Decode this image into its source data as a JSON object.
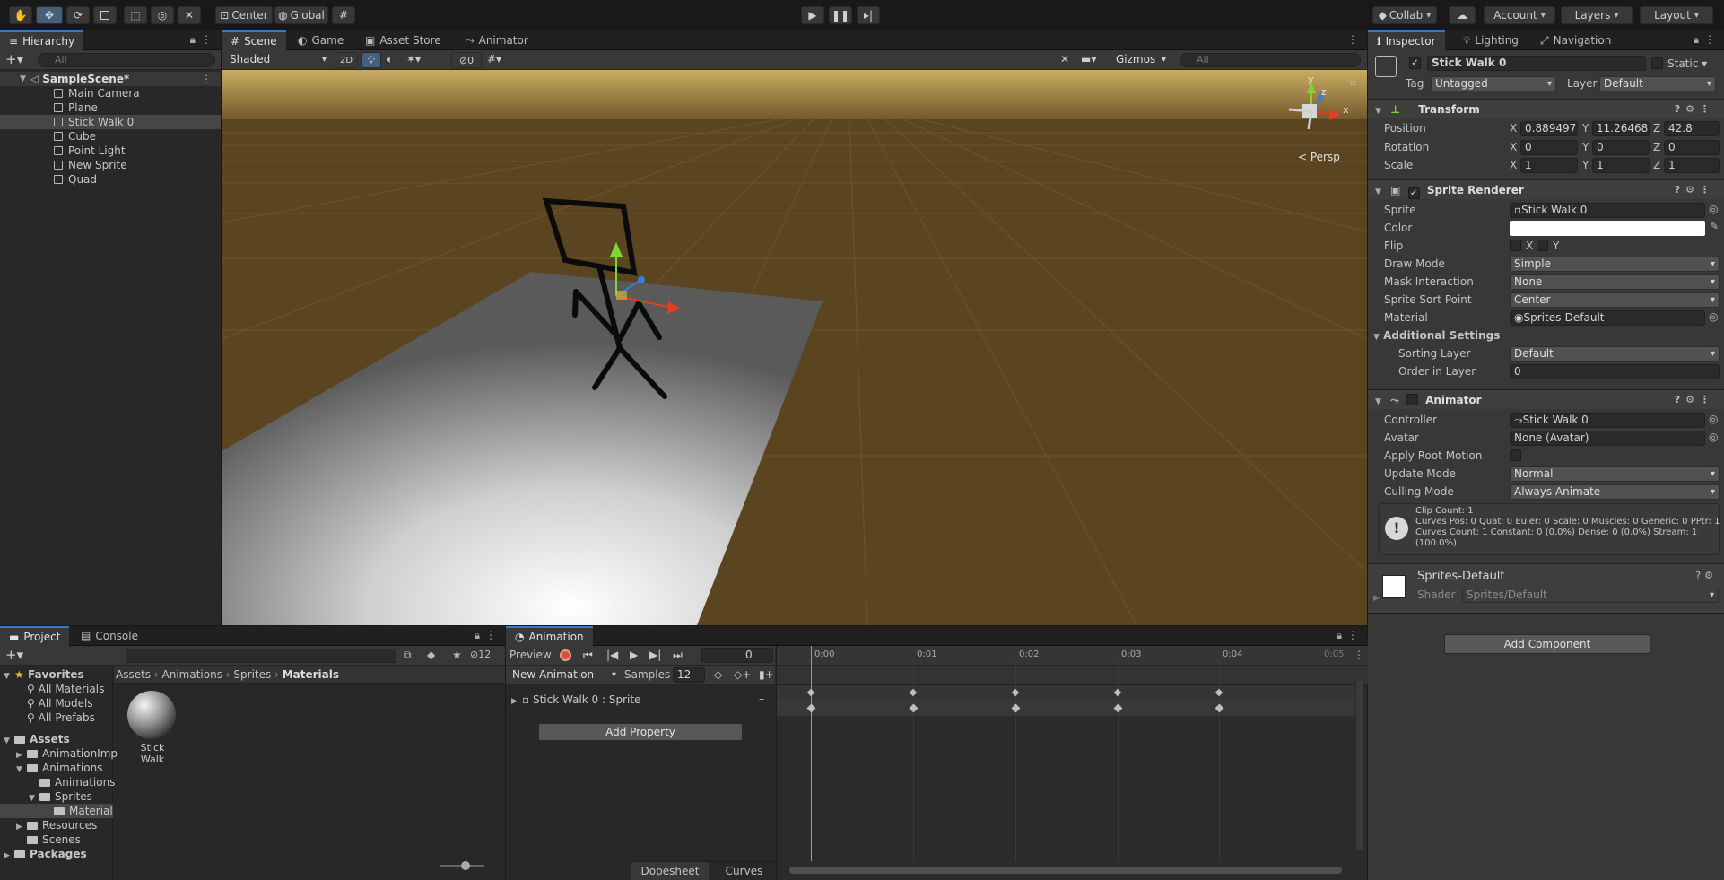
{
  "toolbar": {
    "center_label": "Center",
    "global_label": "Global",
    "collab_label": "Collab",
    "account_label": "Account",
    "layers_label": "Layers",
    "layout_label": "Layout"
  },
  "hierarchy": {
    "tab_label": "Hierarchy",
    "search_placeholder": "All",
    "scene": "SampleScene*",
    "items": [
      "Main Camera",
      "Plane",
      "Stick Walk 0",
      "Cube",
      "Point Light",
      "New Sprite",
      "Quad"
    ]
  },
  "scene_view": {
    "tabs": [
      "Scene",
      "Game",
      "Asset Store",
      "Animator"
    ],
    "shading_mode": "Shaded",
    "mode_2d": "2D",
    "hidden_count": "0",
    "gizmos_label": "Gizmos",
    "search_placeholder": "All",
    "persp_label": "< Persp",
    "axis_y": "y",
    "axis_z": "z",
    "axis_x": "x"
  },
  "inspector": {
    "tabs": [
      "Inspector",
      "Lighting",
      "Navigation"
    ],
    "object_name": "Stick Walk 0",
    "static_label": "Static",
    "tag_label": "Tag",
    "tag_value": "Untagged",
    "layer_label": "Layer",
    "layer_value": "Default",
    "transform": {
      "title": "Transform",
      "position_label": "Position",
      "rotation_label": "Rotation",
      "scale_label": "Scale",
      "position": {
        "x": "0.8894973",
        "y": "11.26468",
        "z": "42.8"
      },
      "rotation": {
        "x": "0",
        "y": "0",
        "z": "0"
      },
      "scale": {
        "x": "1",
        "y": "1",
        "z": "1"
      }
    },
    "sprite_renderer": {
      "title": "Sprite Renderer",
      "sprite_label": "Sprite",
      "sprite_value": "Stick Walk 0",
      "color_label": "Color",
      "flip_label": "Flip",
      "flip_x": "X",
      "flip_y": "Y",
      "draw_mode_label": "Draw Mode",
      "draw_mode_value": "Simple",
      "mask_label": "Mask Interaction",
      "mask_value": "None",
      "sort_point_label": "Sprite Sort Point",
      "sort_point_value": "Center",
      "material_label": "Material",
      "material_value": "Sprites-Default",
      "additional_settings": "Additional Settings",
      "sorting_layer_label": "Sorting Layer",
      "sorting_layer_value": "Default",
      "order_label": "Order in Layer",
      "order_value": "0"
    },
    "animator": {
      "title": "Animator",
      "controller_label": "Controller",
      "controller_value": "Stick Walk 0",
      "avatar_label": "Avatar",
      "avatar_value": "None (Avatar)",
      "root_motion_label": "Apply Root Motion",
      "update_mode_label": "Update Mode",
      "update_mode_value": "Normal",
      "culling_label": "Culling Mode",
      "culling_value": "Always Animate",
      "info_line1": "Clip Count: 1",
      "info_line2": "Curves Pos: 0 Quat: 0 Euler: 0 Scale: 0 Muscles: 0 Generic: 0 PPtr: 1",
      "info_line3": "Curves Count: 1 Constant: 0 (0.0%) Dense: 0 (0.0%) Stream: 1",
      "info_line4": "(100.0%)"
    },
    "material": {
      "name": "Sprites-Default",
      "shader_label": "Shader",
      "shader_value": "Sprites/Default"
    },
    "add_component": "Add Component"
  },
  "project": {
    "tabs": [
      "Project",
      "Console"
    ],
    "hidden_count": "12",
    "favorites_label": "Favorites",
    "favorites": [
      "All Materials",
      "All Models",
      "All Prefabs"
    ],
    "assets_label": "Assets",
    "tree": [
      "AnimationImp",
      "Animations",
      "Animations",
      "Sprites",
      "Materials",
      "Resources",
      "Scenes"
    ],
    "packages_label": "Packages",
    "breadcrumb": [
      "Assets",
      "Animations",
      "Sprites",
      "Materials"
    ],
    "asset_name": "Stick Walk"
  },
  "animation": {
    "tab_label": "Animation",
    "preview_label": "Preview",
    "frame_value": "0",
    "clip_name": "New Animation",
    "samples_label": "Samples",
    "samples_value": "12",
    "property_label": "Stick Walk 0 : Sprite",
    "add_property": "Add Property",
    "ticks": [
      "0:00",
      "0:01",
      "0:02",
      "0:03",
      "0:04",
      "0:05"
    ],
    "dopesheet_label": "Dopesheet",
    "curves_label": "Curves"
  },
  "colors": {
    "accent_blue": "#3a79bb",
    "ground": "#5b4420",
    "sky": "#c9ac63"
  }
}
